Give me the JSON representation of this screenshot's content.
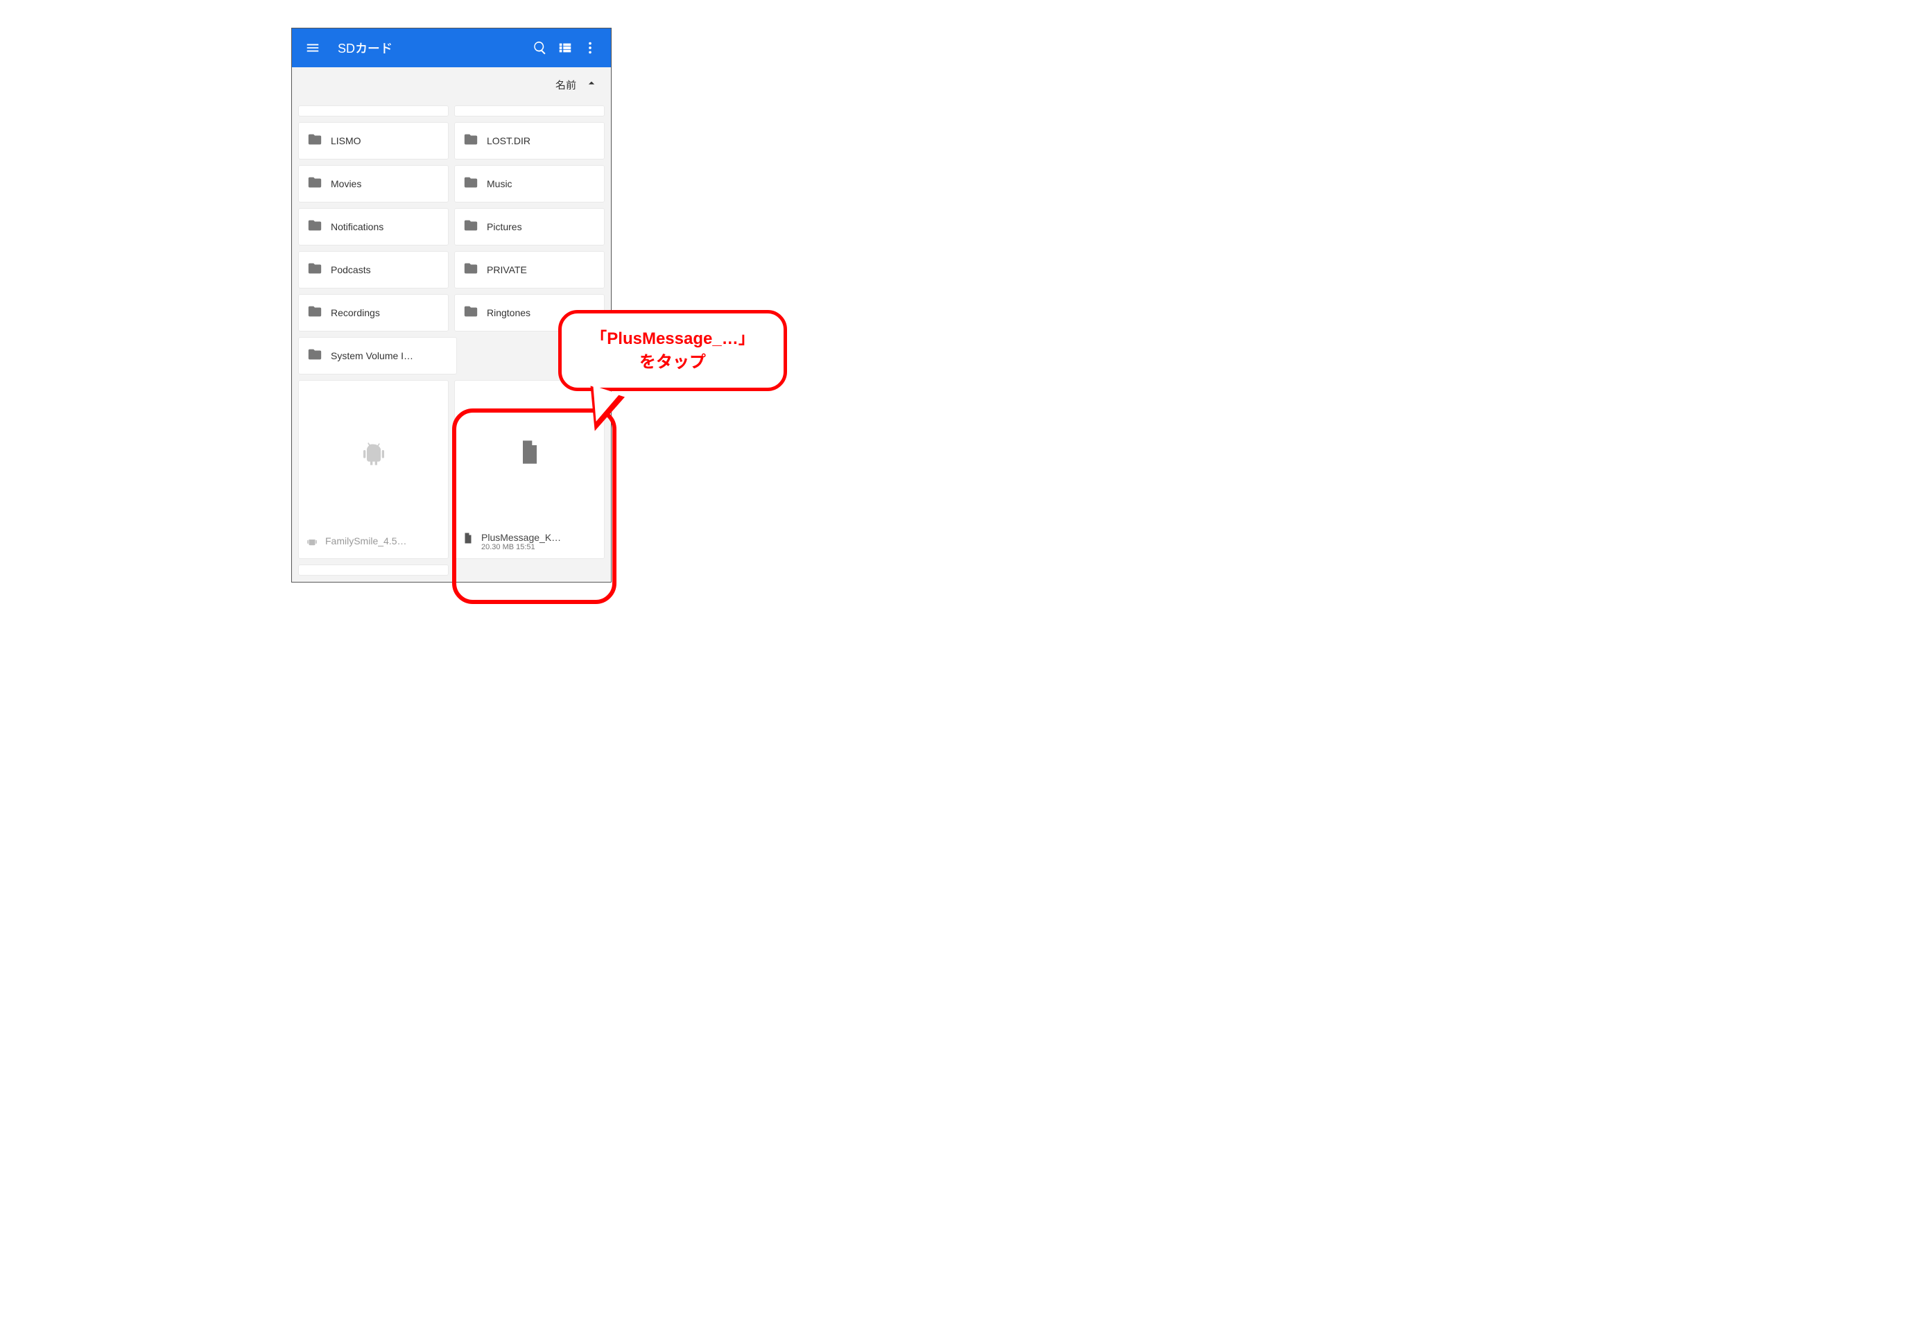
{
  "appbar": {
    "title": "SDカード"
  },
  "sort": {
    "label": "名前"
  },
  "folders": [
    {
      "name": "LISMO"
    },
    {
      "name": "LOST.DIR"
    },
    {
      "name": "Movies"
    },
    {
      "name": "Music"
    },
    {
      "name": "Notifications"
    },
    {
      "name": "Pictures"
    },
    {
      "name": "Podcasts"
    },
    {
      "name": "PRIVATE"
    },
    {
      "name": "Recordings"
    },
    {
      "name": "Ringtones"
    },
    {
      "name": "System Volume I…"
    }
  ],
  "files": [
    {
      "name": "FamilySmile_4.5…",
      "meta": "",
      "icon": "android",
      "muted": true
    },
    {
      "name": "PlusMessage_K…",
      "meta": "20.30 MB 15:51",
      "icon": "file",
      "muted": false
    }
  ],
  "callout": {
    "line1": "「PlusMessage_…」",
    "line2": "をタップ"
  }
}
